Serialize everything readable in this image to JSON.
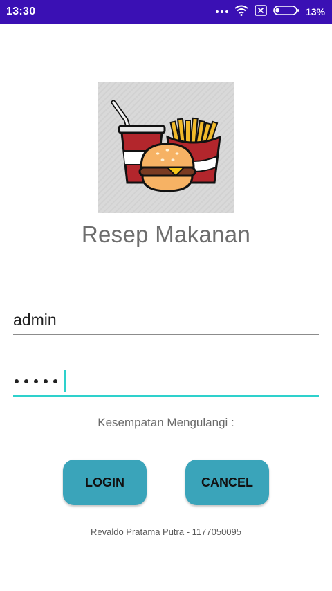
{
  "status_bar": {
    "time": "13:30",
    "battery_percent": "13%",
    "icons": [
      "more-dots-icon",
      "wifi-icon",
      "no-sim-icon",
      "battery-icon"
    ]
  },
  "logo": {
    "icon": "fast-food-icon"
  },
  "app_title": "Resep Makanan",
  "form": {
    "username_value": "admin",
    "password_mask_length": 5,
    "retry_label": "Kesempatan Mengulangi :"
  },
  "buttons": {
    "login_label": "LOGIN",
    "cancel_label": "CANCEL"
  },
  "footer": {
    "credit": "Revaldo Pratama Putra - 1177050095"
  },
  "colors": {
    "status_bar": "#3a10b4",
    "button": "#3aa4ba",
    "focus_accent": "#2ed1cc"
  }
}
